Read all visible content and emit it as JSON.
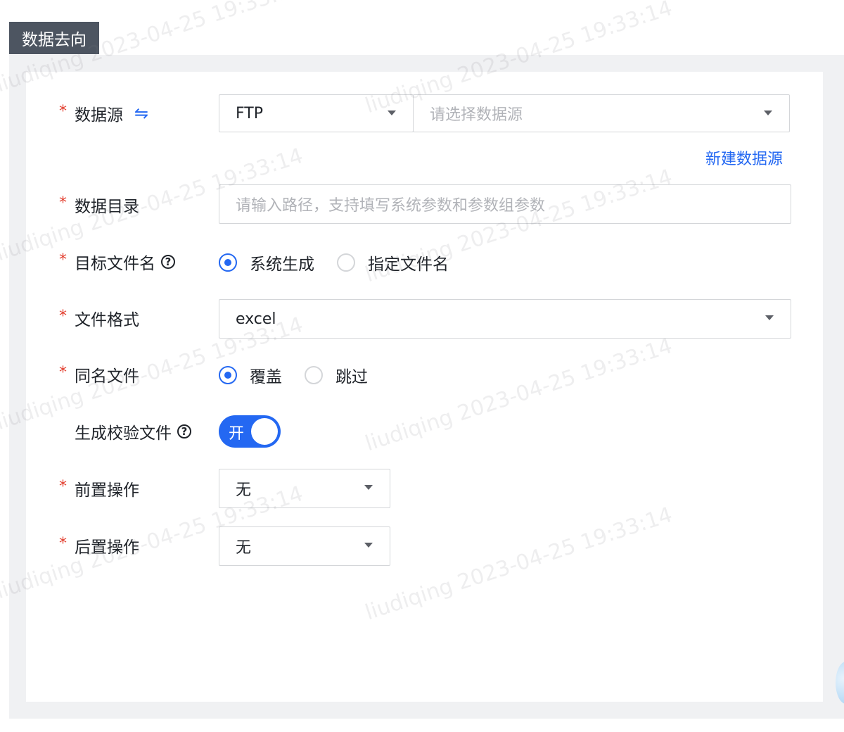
{
  "section": {
    "title": "数据去向"
  },
  "form": {
    "datasource": {
      "label": "数据源",
      "type_value": "FTP",
      "placeholder": "请选择数据源",
      "new_link": "新建数据源"
    },
    "directory": {
      "label": "数据目录",
      "placeholder": "请输入路径，支持填写系统参数和参数组参数"
    },
    "target_filename": {
      "label": "目标文件名",
      "options": [
        "系统生成",
        "指定文件名"
      ],
      "selected": "系统生成"
    },
    "file_format": {
      "label": "文件格式",
      "value": "excel"
    },
    "same_name": {
      "label": "同名文件",
      "options": [
        "覆盖",
        "跳过"
      ],
      "selected": "覆盖"
    },
    "checksum": {
      "label": "生成校验文件",
      "toggle_label": "开",
      "enabled": true
    },
    "pre_action": {
      "label": "前置操作",
      "value": "无"
    },
    "post_action": {
      "label": "后置操作",
      "value": "无"
    }
  },
  "required_mark": "*",
  "icons": {
    "swap": "swap-icon",
    "help": "question-circle-icon",
    "caret": "caret-down-icon"
  },
  "watermark": {
    "user": "liudiqing",
    "text": "2023-04-25 19:33:14"
  },
  "colors": {
    "primary": "#2468f2",
    "required": "#e23c2c",
    "tab_bg": "#4d5561"
  }
}
